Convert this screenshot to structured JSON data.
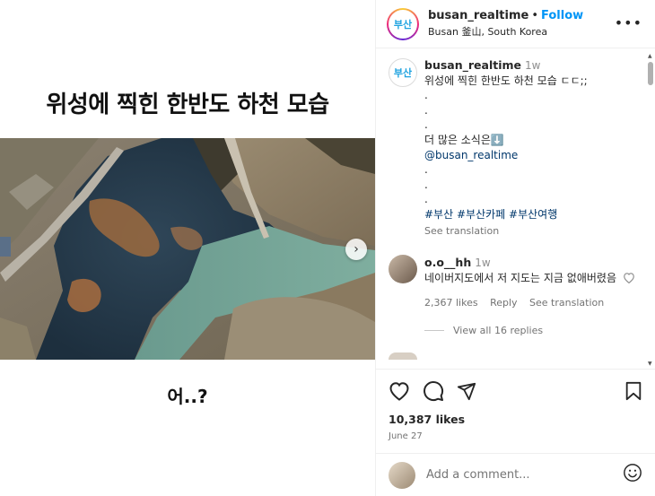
{
  "media": {
    "title": "위성에 찍힌 한반도 하천 모습",
    "caption": "어..?",
    "next_icon": "chevron-right-icon"
  },
  "header": {
    "avatar_text": "부산",
    "username": "busan_realtime",
    "dot": "•",
    "follow": "Follow",
    "location": "Busan 釜山, South Korea",
    "more_icon": "more-icon"
  },
  "caption": {
    "avatar_text": "부산",
    "username": "busan_realtime",
    "time": "1w",
    "lines": [
      "위성에 찍힌 한반도 하천 모습 ㄷㄷ;;",
      ".",
      ".",
      ".",
      "더 많은 소식은⬇️"
    ],
    "mention": "@busan_realtime",
    "dots2": [
      ".",
      ".",
      "."
    ],
    "hashtags": [
      "#부산",
      "#부산카페",
      "#부산여행"
    ],
    "see_translation": "See translation"
  },
  "comment": {
    "username": "o.o__hh",
    "time": "1w",
    "text": "네이버지도에서 저 지도는 지금 없애버렸음",
    "likes": "2,367 likes",
    "reply": "Reply",
    "see_translation": "See translation",
    "view_replies": "View all 16 replies"
  },
  "actions": {
    "likes": "10,387 likes",
    "date": "June 27"
  },
  "add_comment": {
    "placeholder": "Add a comment..."
  },
  "colors": {
    "link_blue": "#0095f6",
    "hashtag": "#00376b",
    "muted": "#737373",
    "logo_blue": "#1fa3e0"
  }
}
